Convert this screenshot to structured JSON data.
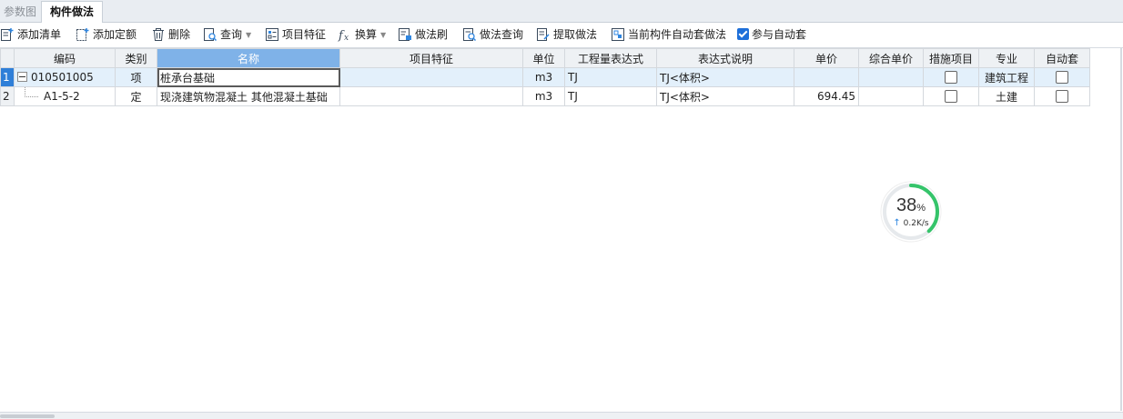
{
  "tabs": [
    {
      "label": "参数图",
      "active": false
    },
    {
      "label": "构件做法",
      "active": true
    }
  ],
  "toolbar": {
    "add_list": "添加清单",
    "add_quota": "添加定额",
    "delete": "删除",
    "query": "查询",
    "item_features": "项目特征",
    "convert": "换算",
    "method_brush": "做法刷",
    "method_query": "做法查询",
    "extract_method": "提取做法",
    "auto_apply_current": "当前构件自动套做法",
    "participate_auto": "参与自动套",
    "participate_auto_checked": true
  },
  "table": {
    "columns": [
      "编码",
      "类别",
      "名称",
      "项目特征",
      "单位",
      "工程量表达式",
      "表达式说明",
      "单价",
      "综合单价",
      "措施项目",
      "专业",
      "自动套"
    ],
    "rows": [
      {
        "num": "1",
        "code": "010501005",
        "category": "项",
        "name": "桩承台基础",
        "features": "",
        "unit": "m3",
        "expr": "TJ",
        "expr_desc": "TJ<体积>",
        "price": "",
        "comp_price": "",
        "measure": false,
        "specialty": "建筑工程",
        "auto": false
      },
      {
        "num": "2",
        "code": "A1-5-2",
        "category": "定",
        "name": "现浇建筑物混凝土 其他混凝土基础",
        "features": "",
        "unit": "m3",
        "expr": "TJ",
        "expr_desc": "TJ<体积>",
        "price": "694.45",
        "comp_price": "",
        "measure": false,
        "specialty": "土建",
        "auto": false
      }
    ]
  },
  "gauge": {
    "value": "38",
    "unit": "%",
    "speed": "0.2K/s",
    "progress": 0.38,
    "color": "#35c46a"
  }
}
